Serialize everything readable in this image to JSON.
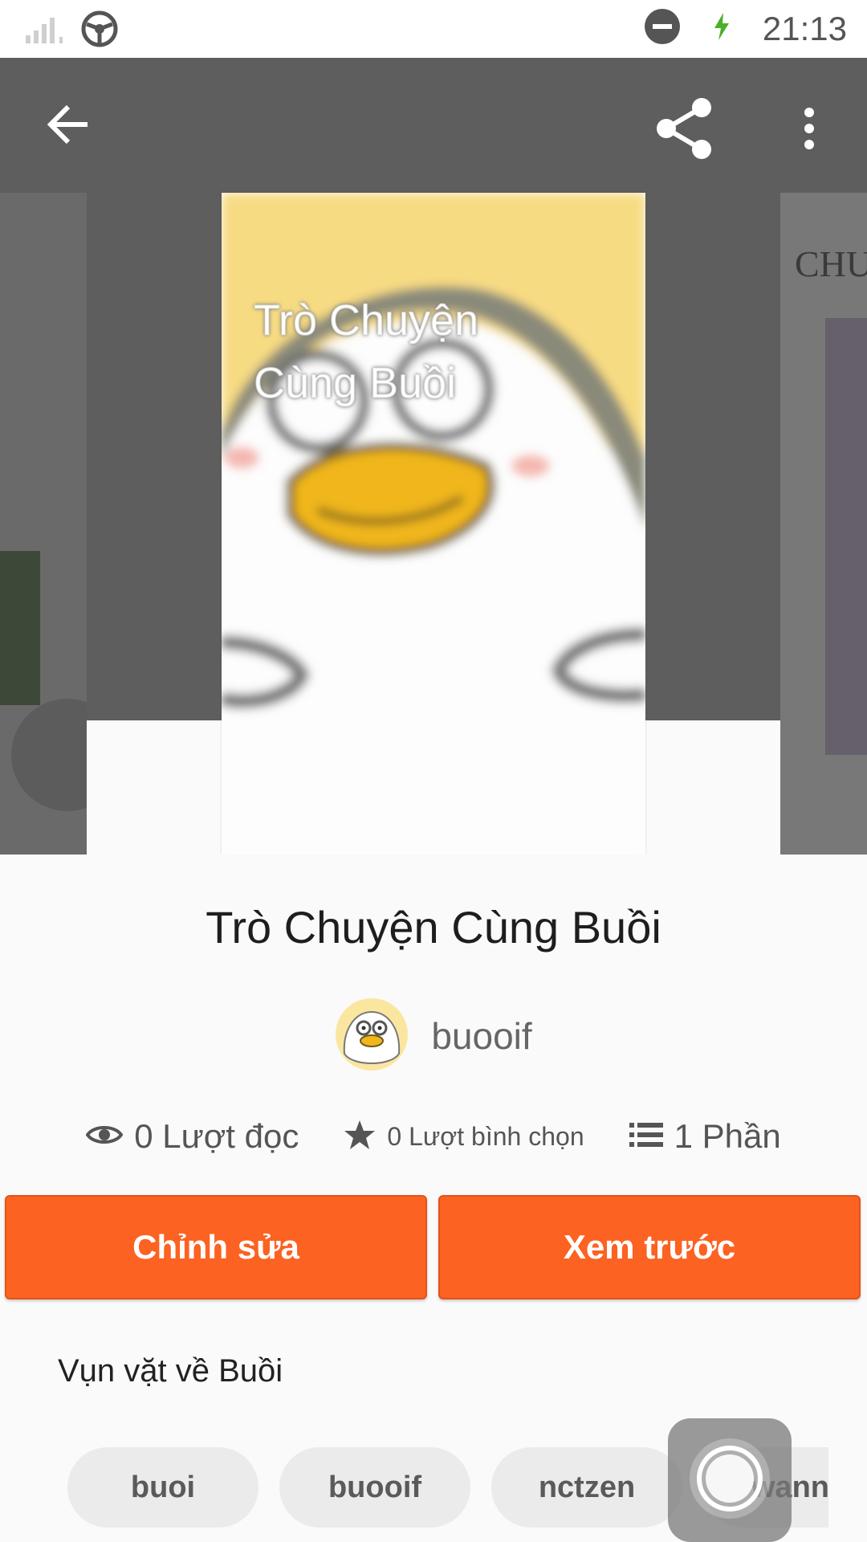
{
  "status_bar": {
    "time": "21:13",
    "icons": [
      "signal-icon",
      "steering-icon",
      "dnd-icon",
      "charging-icon"
    ]
  },
  "toolbar": {
    "icons": [
      "back-arrow-icon",
      "share-icon",
      "more-vert-icon"
    ]
  },
  "cover": {
    "title_line1": "Trò Chuyện",
    "title_line2": "Cùng Buồi",
    "right_peek_text": "CHU"
  },
  "book": {
    "title": "Trò Chuyện Cùng Buồi",
    "author": "buooif"
  },
  "stats": {
    "reads": "0 Lượt đọc",
    "votes": "0 Lượt bình chọn",
    "parts": "1 Phần"
  },
  "actions": {
    "edit": "Chỉnh sửa",
    "preview": "Xem trước"
  },
  "description": "Vụn vặt về Buồi",
  "tags": [
    "buoi",
    "buooif",
    "nctzen",
    "wanna"
  ],
  "colors": {
    "accent": "#fc6221",
    "header_bg": "#5e5e5e"
  }
}
